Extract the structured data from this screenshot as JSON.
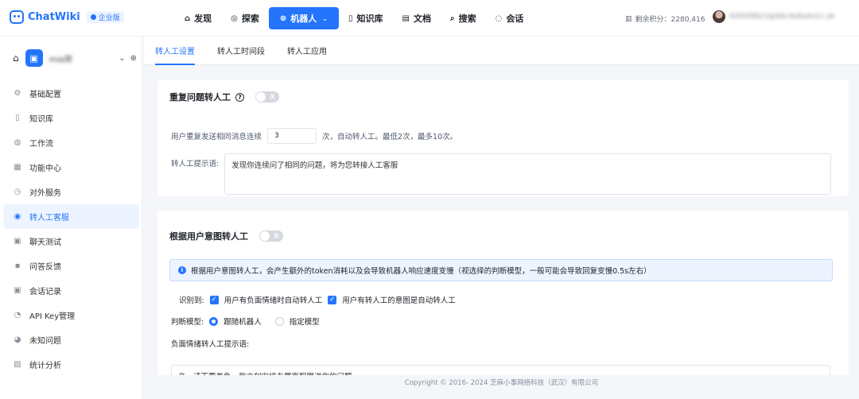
{
  "brand": {
    "name": "ChatWiki",
    "edition": "企业版"
  },
  "nav": [
    {
      "label": "发现",
      "icon": "compass-icon",
      "glyph": "⌂"
    },
    {
      "label": "探索",
      "icon": "explore-icon",
      "glyph": "◎"
    },
    {
      "label": "机器人",
      "icon": "robot-icon",
      "glyph": "⊕",
      "active": true
    },
    {
      "label": "知识库",
      "icon": "book-icon",
      "glyph": "▯"
    },
    {
      "label": "文档",
      "icon": "document-icon",
      "glyph": "▤"
    },
    {
      "label": "搜索",
      "icon": "search-icon",
      "glyph": "⌕"
    },
    {
      "label": "会话",
      "icon": "chat-icon",
      "glyph": "◌"
    }
  ],
  "points": {
    "text": "剩余积分：2280,416"
  },
  "user": {
    "name": "6000f9823@66c9e8a4cb1.ak"
  },
  "robot": {
    "name": "mia测"
  },
  "sidebar": [
    {
      "label": "基础配置",
      "icon": "gear-icon",
      "glyph": "⚙"
    },
    {
      "label": "知识库",
      "icon": "book-icon",
      "glyph": "▯"
    },
    {
      "label": "工作流",
      "icon": "workflow-icon",
      "glyph": "◍"
    },
    {
      "label": "功能中心",
      "icon": "grid-icon",
      "glyph": "▦"
    },
    {
      "label": "对外服务",
      "icon": "service-icon",
      "glyph": "◷"
    },
    {
      "label": "转人工客服",
      "icon": "agent-icon",
      "glyph": "◉",
      "active": true
    },
    {
      "label": "聊天测试",
      "icon": "chat-test-icon",
      "glyph": "▣"
    },
    {
      "label": "问答反馈",
      "icon": "feedback-icon",
      "glyph": "▪"
    },
    {
      "label": "会话记录",
      "icon": "record-icon",
      "glyph": "▣"
    },
    {
      "label": "API Key管理",
      "icon": "key-icon",
      "glyph": "◔"
    },
    {
      "label": "未知问题",
      "icon": "question-icon",
      "glyph": "◕"
    },
    {
      "label": "统计分析",
      "icon": "chart-icon",
      "glyph": "▨"
    }
  ],
  "tabs": [
    {
      "label": "转人工设置",
      "active": true
    },
    {
      "label": "转人工时间段"
    },
    {
      "label": "转人工应用"
    }
  ],
  "section1": {
    "title": "重复问题转人工",
    "toggle": "关",
    "repeat_prefix": "用户重复发送相同消息连续",
    "repeat_value": "3",
    "repeat_suffix": "次，自动转人工。最低2次，最多10次。",
    "prompt_label": "转人工提示语:",
    "prompt_value": "发现你连续问了相同的问题，将为您转接人工客服"
  },
  "section2": {
    "title": "根据用户意图转人工",
    "toggle": "关",
    "alert": "根据用户意图转人工，会产生额外的token消耗以及会导致机器人响应速度变慢（视选择的判断模型，一般可能会导致回复变慢0.5s左右）",
    "identify_label": "识别到:",
    "check1": "用户有负面情绪时自动转人工",
    "check2": "用户有转人工的意图是自动转人工",
    "model_label": "判断模型:",
    "radio1": "跟随机器人",
    "radio2": "指定模型",
    "neg_label": "负面情绪转人工提示语:",
    "neg_value": "亲，请不要着急，我立刻安排专属客服跟进你的问题"
  },
  "footer": "Copyright © 2016- 2024 芝麻小事网络科技（武汉）有限公司"
}
